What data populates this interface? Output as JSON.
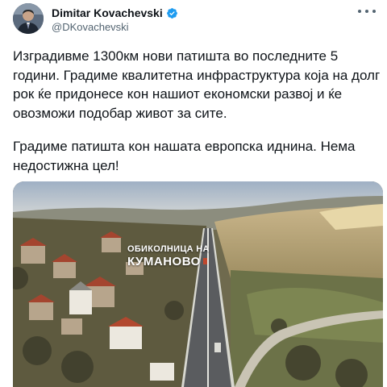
{
  "author": {
    "display_name": "Dimitar Kovachevski",
    "handle": "@DKovachevski",
    "verified": true,
    "avatar_icon": "profile-photo"
  },
  "more_icon": "more-horizontal-icon",
  "tweet": {
    "paragraph_1": "Изградивме 1300км нови патишта во последните 5 години. Градиме квалитетна инфраструктура која на долг рок ќе придонесе кон нашиот економски развој и ќе овозможи подобар живот за сите.",
    "paragraph_2": "Градиме патишта кон нашата европска иднина. Нема недостижна цел!"
  },
  "media": {
    "caption_small": "ОБИКОЛНИЦА НА",
    "caption_big": "КУМАНОВО"
  },
  "colors": {
    "verified_blue": "#1d9bf0",
    "text_primary": "#0f1419",
    "text_secondary": "#536471"
  }
}
